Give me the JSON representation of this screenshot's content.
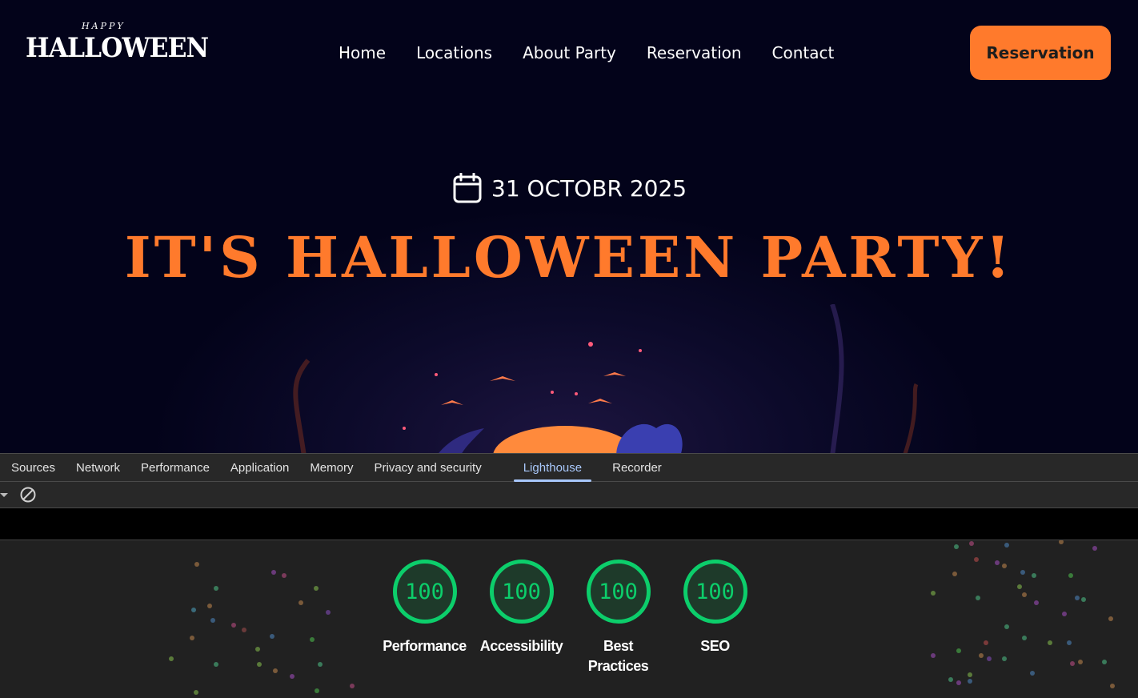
{
  "site": {
    "logo": {
      "small": "HAPPY",
      "word": "HALLOWEEN"
    },
    "nav": [
      "Home",
      "Locations",
      "About Party",
      "Reservation",
      "Contact"
    ],
    "cta": "Reservation",
    "date": "31 OCTOBR 2025",
    "headline": "IT'S HALLOWEEN PARTY!",
    "accent": "#ff7a2c"
  },
  "devtools": {
    "tabs": [
      "Sources",
      "Network",
      "Performance",
      "Application",
      "Memory",
      "Privacy and security",
      "Lighthouse",
      "Recorder"
    ],
    "active_tab": "Lighthouse",
    "scores": [
      {
        "value": "100",
        "label": "Performance"
      },
      {
        "value": "100",
        "label": "Accessibility"
      },
      {
        "value": "100",
        "label": "Best Practices"
      },
      {
        "value": "100",
        "label": "SEO"
      }
    ],
    "score_color": "#0cce6b"
  }
}
